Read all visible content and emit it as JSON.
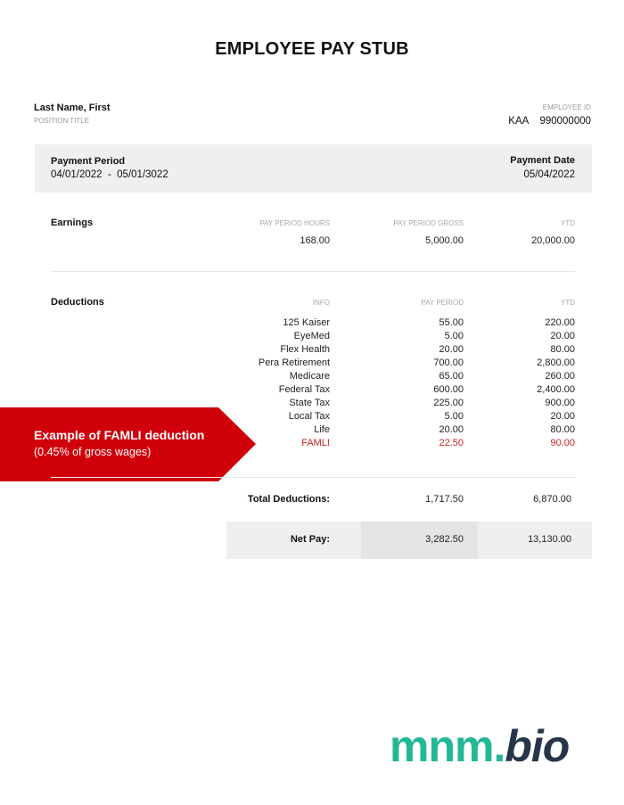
{
  "title": "EMPLOYEE PAY STUB",
  "employee": {
    "name": "Last Name, First",
    "position": "POSITION TITLE",
    "id_label": "EMPLOYEE ID",
    "id_value": "KAA    990000000"
  },
  "period": {
    "payment_period_label": "Payment Period",
    "payment_period_value": "04/01/2022  -  05/01/3022",
    "payment_date_label": "Payment Date",
    "payment_date_value": "05/04/2022"
  },
  "earnings": {
    "label": "Earnings",
    "headers": {
      "hours": "PAY PERIOD HOURS",
      "gross": "PAY PERIOD GROSS",
      "ytd": "YTD"
    },
    "hours": "168.00",
    "gross": "5,000.00",
    "ytd": "20,000.00"
  },
  "deductions": {
    "label": "Deductions",
    "headers": {
      "info": "INFO",
      "period": "PAY PERIOD",
      "ytd": "YTD"
    },
    "rows": [
      {
        "info": "125 Kaiser",
        "period": "55.00",
        "ytd": "220.00"
      },
      {
        "info": "EyeMed",
        "period": "5.00",
        "ytd": "20.00"
      },
      {
        "info": "Flex Health",
        "period": "20.00",
        "ytd": "80.00"
      },
      {
        "info": "Pera Retirement",
        "period": "700.00",
        "ytd": "2,800.00"
      },
      {
        "info": "Medicare",
        "period": "65.00",
        "ytd": "260.00"
      },
      {
        "info": "Federal Tax",
        "period": "600.00",
        "ytd": "2,400.00"
      },
      {
        "info": "State Tax",
        "period": "225.00",
        "ytd": "900.00"
      },
      {
        "info": "Local Tax",
        "period": "5.00",
        "ytd": "20.00"
      },
      {
        "info": "Life",
        "period": "20.00",
        "ytd": "80.00"
      },
      {
        "info": "FAMLI",
        "period": "22.50",
        "ytd": "90.00"
      }
    ]
  },
  "callout": {
    "title": "Example of FAMLI deduction",
    "subtitle": "(0.45% of gross wages)",
    "color": "#d0000b"
  },
  "totals": {
    "total_label": "Total Deductions:",
    "total_period": "1,717.50",
    "total_ytd": "6,870.00",
    "net_label": "Net Pay:",
    "net_period": "3,282.50",
    "net_ytd": "13,130.00"
  },
  "logo": {
    "part1": "mnm.",
    "part2": "bio"
  },
  "colors": {
    "accent_red": "#cc2222",
    "logo_green": "#22b896",
    "logo_navy": "#263547"
  }
}
